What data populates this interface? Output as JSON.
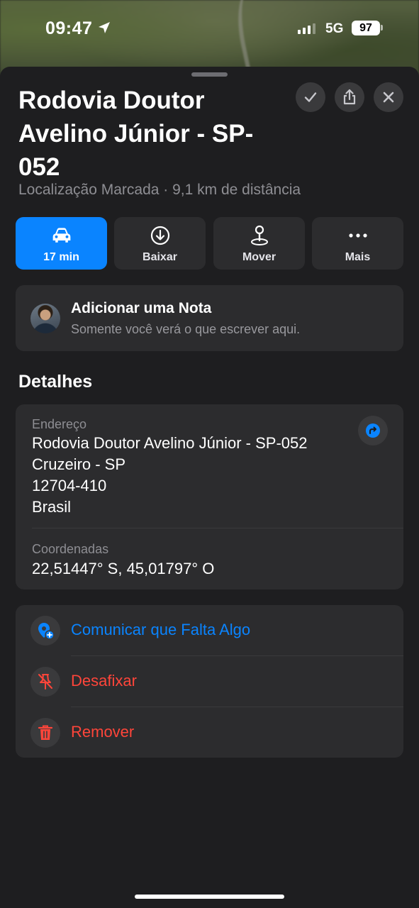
{
  "status_bar": {
    "time": "09:47",
    "network": "5G",
    "battery": "97"
  },
  "place": {
    "title": "Rodovia Doutor Avelino Júnior - SP-052",
    "subtitle": "Localização Marcada · 9,1 km de distância"
  },
  "header_buttons": {
    "confirm_icon": "checkmark-icon",
    "share_icon": "share-icon",
    "close_icon": "close-icon"
  },
  "actions": [
    {
      "label": "17 min",
      "icon": "car-icon",
      "primary": true
    },
    {
      "label": "Baixar",
      "icon": "download-icon"
    },
    {
      "label": "Mover",
      "icon": "pin-move-icon"
    },
    {
      "label": "Mais",
      "icon": "ellipsis-icon"
    }
  ],
  "note": {
    "title": "Adicionar uma Nota",
    "subtitle": "Somente você verá o que escrever aqui."
  },
  "details": {
    "section_title": "Detalhes",
    "address_label": "Endereço",
    "address_lines": [
      "Rodovia Doutor Avelino Júnior - SP-052",
      "Cruzeiro - SP",
      "12704-410",
      "Brasil"
    ],
    "coords_label": "Coordenadas",
    "coords_value": "22,51447° S, 45,01797° O"
  },
  "list_actions": [
    {
      "label": "Comunicar que Falta Algo",
      "icon": "report-pin-icon",
      "color": "#0a84ff"
    },
    {
      "label": "Desafixar",
      "icon": "unpin-icon",
      "color": "#ff453a"
    },
    {
      "label": "Remover",
      "icon": "trash-icon",
      "color": "#ff453a"
    }
  ],
  "colors": {
    "accent": "#0a84ff",
    "destructive": "#ff453a",
    "sheet_bg": "#1e1e20",
    "card_bg": "#2c2c2e"
  }
}
